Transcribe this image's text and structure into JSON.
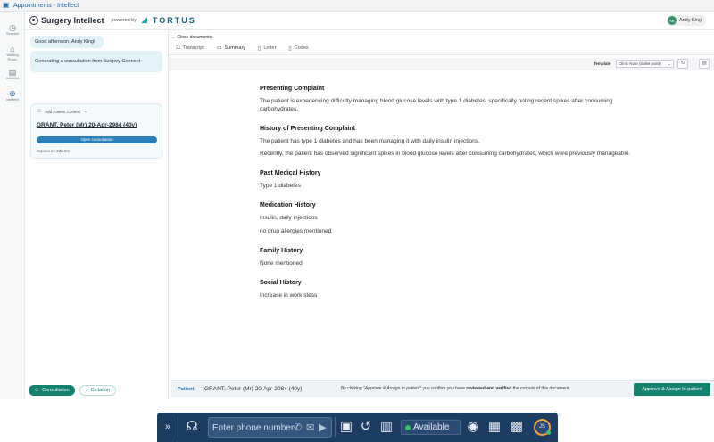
{
  "window": {
    "title": "Appointments - Intellect"
  },
  "header": {
    "app_name": "Surgery Intellect",
    "powered_by": "powered by",
    "partner": "TORTUS",
    "user": {
      "initials": "AK",
      "name": "Andy King"
    }
  },
  "rail": {
    "items": [
      {
        "label": "Session",
        "icon": "clock-icon"
      },
      {
        "label": "Waiting Room",
        "icon": "building-icon"
      },
      {
        "label": "Worklist",
        "icon": "inbox-icon"
      },
      {
        "label": "Intellect",
        "icon": "globe-icon",
        "active": true
      }
    ]
  },
  "chat": {
    "greeting": "Good afternoon, Andy King!",
    "status": "Generating a consultation from Surgery Connect",
    "context_label": "Add Patient Context",
    "patient": "GRANT, Peter (Mr) 20-Apr-2984 (40y)",
    "open_button": "Open consultation",
    "expires": "Expires in: 22h 8m",
    "footer": {
      "consultation": "Consultation",
      "dictation": "Dictation"
    }
  },
  "main": {
    "close_label": "Close documents",
    "tabs": [
      {
        "label": "Transcript",
        "icon": "lock-icon"
      },
      {
        "label": "Summary",
        "icon": "document-icon",
        "active": true
      },
      {
        "label": "Letter",
        "icon": "letter-icon"
      },
      {
        "label": "Codes",
        "icon": "code-icon"
      }
    ],
    "template_label": "Template",
    "template_value": "Clinic Note (bullet point)"
  },
  "document": {
    "sections": [
      {
        "heading": "Presenting Complaint",
        "paragraphs": [
          "The patient is experiencing difficulty managing blood glucose levels with type 1 diabetes, specifically noting recent spikes after consuming carbohydrates."
        ]
      },
      {
        "heading": "History of Presenting Complaint",
        "paragraphs": [
          "The patient has type 1 diabetes and has been managing it with daily insulin injections.",
          "Recently, the patient has observed significant spikes in blood glucose levels after consuming carbohydrates, which were previously manageable."
        ]
      },
      {
        "heading": "Past Medical History",
        "paragraphs": [
          "Type 1 diabetes"
        ]
      },
      {
        "heading": "Medication History",
        "paragraphs": [
          "Insulin, daily injections",
          "no drug allergies mentioned"
        ]
      },
      {
        "heading": "Family History",
        "paragraphs": [
          "None mentioned"
        ]
      },
      {
        "heading": "Social History",
        "paragraphs": [
          "Increase in work stess"
        ]
      }
    ]
  },
  "patient_bar": {
    "label": "Patient",
    "value": "GRANT, Peter (Mr) 20-Apr-2984 (40y)",
    "notice_pre": "By clicking ",
    "notice_quote": "\"Approve & Assign to patient\"",
    "notice_mid": " you confirm you have ",
    "notice_bold": "reviewed and verified",
    "notice_post": " the outputs of this document.",
    "approve_button": "Approve & Assign to patient"
  },
  "phonebar": {
    "placeholder": "Enter phone number",
    "status": "Available",
    "avatar_initials": "JS"
  }
}
